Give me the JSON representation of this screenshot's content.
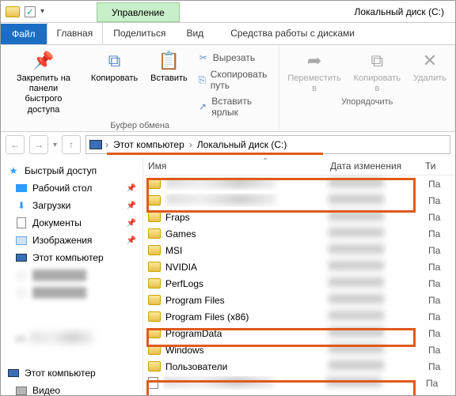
{
  "titlebar": {
    "tool_tab": "Управление",
    "title": "Локальный диск (C:)"
  },
  "tabs": {
    "file": "Файл",
    "home": "Главная",
    "share": "Поделиться",
    "view": "Вид",
    "drive": "Средства работы с дисками"
  },
  "ribbon": {
    "pin": "Закрепить на панели\nбыстрого доступа",
    "copy": "Копировать",
    "paste": "Вставить",
    "cut": "Вырезать",
    "copy_path": "Скопировать путь",
    "paste_shortcut": "Вставить ярлык",
    "clipboard_group": "Буфер обмена",
    "move_to": "Переместить в",
    "copy_to": "Копировать в",
    "delete": "Удалить",
    "organize_group": "Упорядочить"
  },
  "breadcrumb": {
    "root": "Этот компьютер",
    "leaf": "Локальный диск (C:)"
  },
  "columns": {
    "name": "Имя",
    "date": "Дата изменения",
    "type": "Ти"
  },
  "sidebar": {
    "quick": "Быстрый доступ",
    "desktop": "Рабочий стол",
    "downloads": "Загрузки",
    "documents": "Документы",
    "pictures": "Изображения",
    "thispc": "Этот компьютер",
    "blur1": "████████",
    "blur2": "████████",
    "ud": "уд",
    "thispc2": "Этот компьютер",
    "videos": "Видео"
  },
  "folders": [
    {
      "name": "",
      "blurred": true
    },
    {
      "name": "",
      "blurred": true
    },
    {
      "name": "Fraps"
    },
    {
      "name": "Games"
    },
    {
      "name": "MSI"
    },
    {
      "name": "NVIDIA"
    },
    {
      "name": "PerfLogs"
    },
    {
      "name": "Program Files"
    },
    {
      "name": "Program Files (x86)"
    },
    {
      "name": "ProgramData"
    },
    {
      "name": "Windows"
    },
    {
      "name": "Пользователи"
    }
  ],
  "filetype": "Па",
  "last_row_blurred": true
}
